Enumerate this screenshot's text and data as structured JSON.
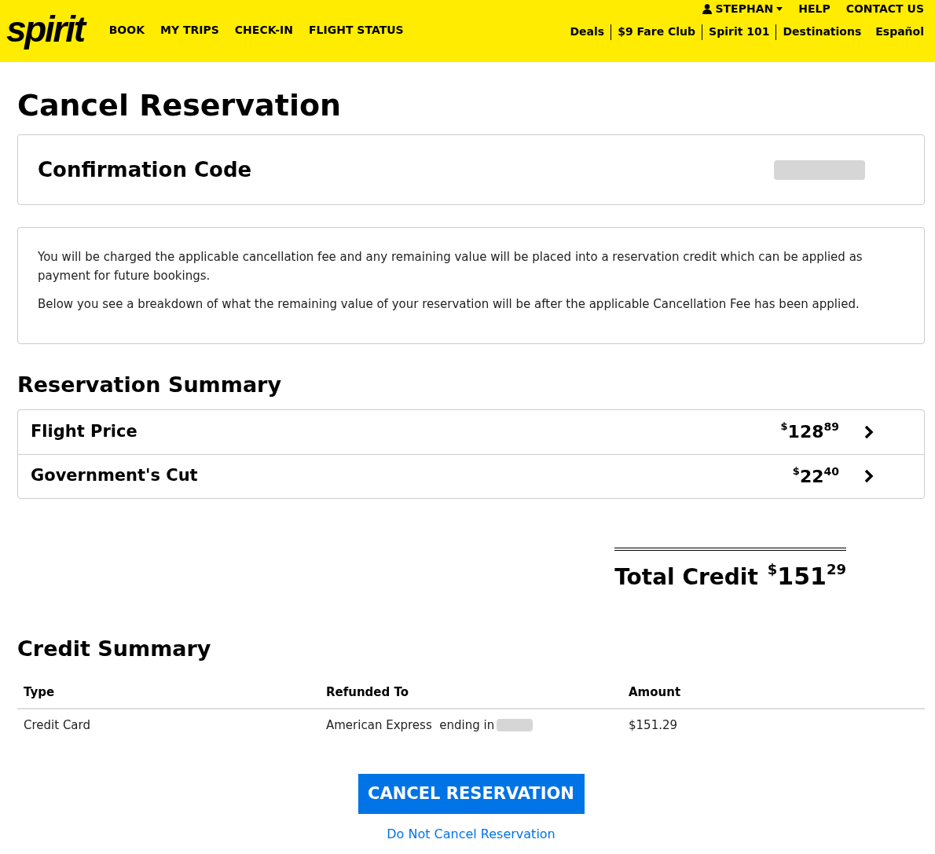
{
  "header": {
    "logo": "spirit",
    "nav": [
      "BOOK",
      "MY TRIPS",
      "CHECK-IN",
      "FLIGHT STATUS"
    ],
    "user": "STEPHAN",
    "top_links": [
      "HELP",
      "CONTACT US"
    ],
    "sub_links": [
      "Deals",
      "$9 Fare Club",
      "Spirit 101",
      "Destinations",
      "Español"
    ]
  },
  "title": "Cancel Reservation",
  "confirmation": {
    "label": "Confirmation Code"
  },
  "notice": [
    "You will be charged the applicable cancellation fee and any remaining value will be placed into a reservation credit which can be applied as payment for future bookings.",
    "Below you see a breakdown of what the remaining value of your reservation will be after the applicable Cancellation Fee has been applied."
  ],
  "reservation_summary": {
    "title": "Reservation Summary",
    "rows": [
      {
        "label": "Flight Price",
        "currency": "$",
        "whole": "128",
        "cents": "89"
      },
      {
        "label": "Government's Cut",
        "currency": "$",
        "whole": "22",
        "cents": "40"
      }
    ]
  },
  "total": {
    "label": "Total Credit",
    "currency": "$",
    "whole": "151",
    "cents": "29"
  },
  "credit_summary": {
    "title": "Credit Summary",
    "columns": [
      "Type",
      "Refunded To",
      "Amount"
    ],
    "rows": [
      {
        "type": "Credit Card",
        "refunded_to": "American Express  ending in",
        "amount": "$151.29"
      }
    ]
  },
  "primary_button": "CANCEL RESERVATION",
  "secondary_link": "Do Not Cancel Reservation"
}
